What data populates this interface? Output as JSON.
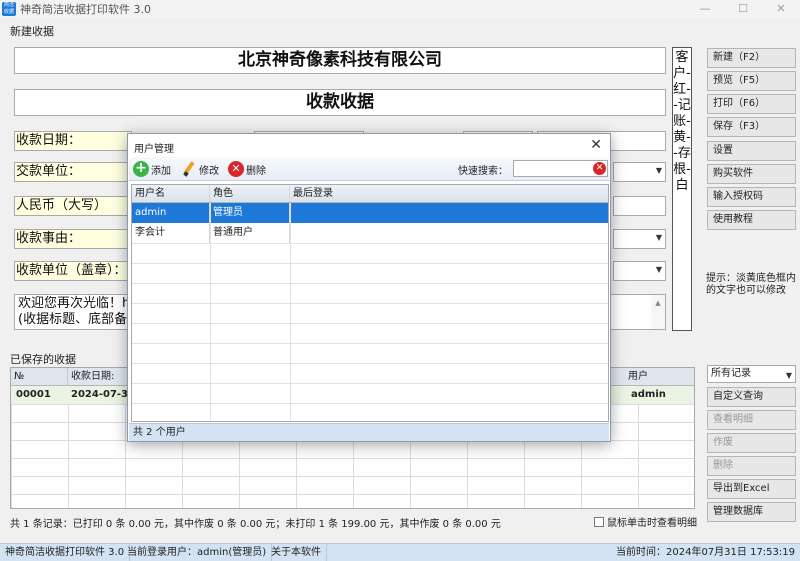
{
  "window": {
    "title": "神奇简洁收据打印软件 3.0",
    "icon_text": "简洁收据",
    "controls": [
      "—",
      "☐",
      "✕"
    ]
  },
  "form": {
    "section_label": "新建收据",
    "company": "北京神奇像素科技有限公司",
    "receipt_title": "收款收据",
    "rows": [
      {
        "label": "收款日期："
      },
      {
        "label": "交款单位："
      },
      {
        "label": "人民币（大写）"
      },
      {
        "label": "收款事由："
      },
      {
        "label": "收款单位（盖章）："
      }
    ],
    "note_line1": "欢迎您再次光临！ht",
    "note_line2": "(收据标题、底部备注",
    "vertical_copy": "客户-红--记账-黄--存根-白"
  },
  "buttons": {
    "new": "新建（F2）",
    "preview": "预览（F5）",
    "print": "打印（F6）",
    "save": "保存（F3）",
    "settings": "设置",
    "buy": "购买软件",
    "license": "输入授权码",
    "tutorial": "使用教程",
    "hint": "提示：淡黄底色框内的文字也可以修改",
    "filter_value": "所有记录",
    "custom_query": "自定义查询",
    "view_detail": "查看明细",
    "void": "作废",
    "delete": "删除",
    "export": "导出到Excel",
    "manage_db": "管理数据库"
  },
  "saved": {
    "section_label": "已保存的收据",
    "headers": {
      "no": "№",
      "date": "收款日期:",
      "user": "用户"
    },
    "row": {
      "no": "00001",
      "date": "2024-07-31",
      "user": "admin"
    },
    "summary": "共 1 条记录：已打印 0 条 0.00 元，其中作废 0 条 0.00 元；未打印 1 条 199.00 元，其中作废 0 条 0.00 元",
    "checkbox_label": "鼠标单击时查看明细"
  },
  "statusbar": {
    "app": "神奇简洁收据打印软件 3.0",
    "user": "当前登录用户：admin(管理员)",
    "about": "关于本软件",
    "time": "当前时间：2024年07月31日 17:53:19"
  },
  "dialog": {
    "title": "用户管理",
    "close": "✕",
    "add": "添加",
    "edit": "修改",
    "delete": "删除",
    "search_label": "快速搜索：",
    "columns": [
      "用户名",
      "角色",
      "最后登录"
    ],
    "users": [
      {
        "name": "admin",
        "role": "管理员",
        "last_login": ""
      },
      {
        "name": "李会计",
        "role": "普通用户",
        "last_login": ""
      }
    ],
    "status": "共 2 个用户"
  }
}
